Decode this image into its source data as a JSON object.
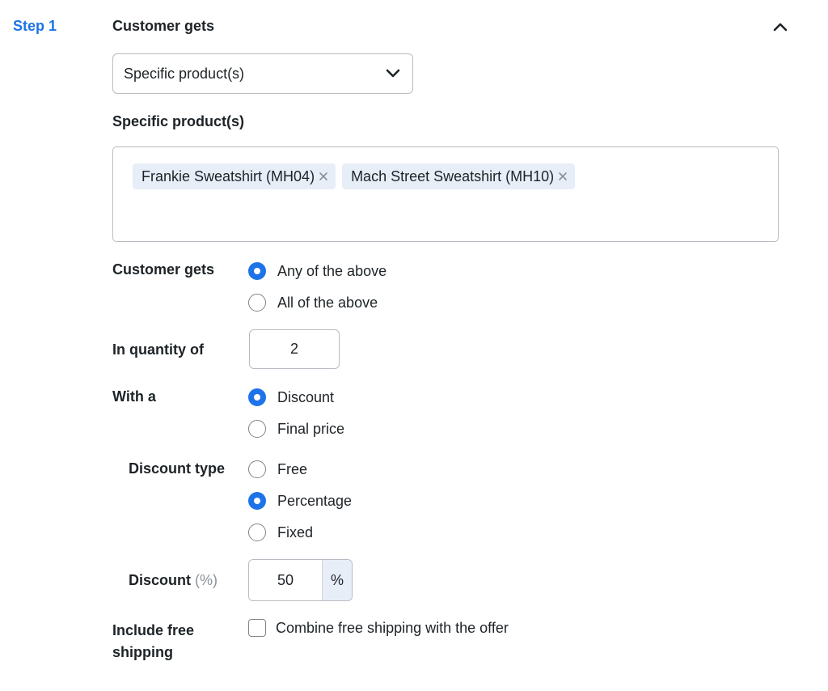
{
  "step": {
    "label": "Step 1",
    "title": "Customer gets"
  },
  "product_select": {
    "value": "Specific product(s)"
  },
  "products_field": {
    "label": "Specific product(s)",
    "tokens": [
      {
        "label": "Frankie Sweatshirt (MH04)"
      },
      {
        "label": "Mach Street Sweatshirt (MH10)"
      }
    ]
  },
  "customer_gets": {
    "label": "Customer gets",
    "options": [
      {
        "label": "Any of the above",
        "selected": true
      },
      {
        "label": "All of the above",
        "selected": false
      }
    ]
  },
  "quantity": {
    "label": "In quantity of",
    "value": "2"
  },
  "with_a": {
    "label": "With a",
    "options": [
      {
        "label": "Discount",
        "selected": true
      },
      {
        "label": "Final price",
        "selected": false
      }
    ]
  },
  "discount_type": {
    "label": "Discount type",
    "options": [
      {
        "label": "Free",
        "selected": false
      },
      {
        "label": "Percentage",
        "selected": true
      },
      {
        "label": "Fixed",
        "selected": false
      }
    ]
  },
  "discount": {
    "label": "Discount",
    "unit_hint": "(%)",
    "value": "50",
    "suffix": "%"
  },
  "free_shipping": {
    "label_line1": "Include free",
    "label_line2": "shipping",
    "checkbox_label": "Combine free shipping with the offer",
    "checked": false
  },
  "colors": {
    "accent": "#1e73e8",
    "token_bg": "#e8eef8",
    "border": "#b8bcc2"
  }
}
